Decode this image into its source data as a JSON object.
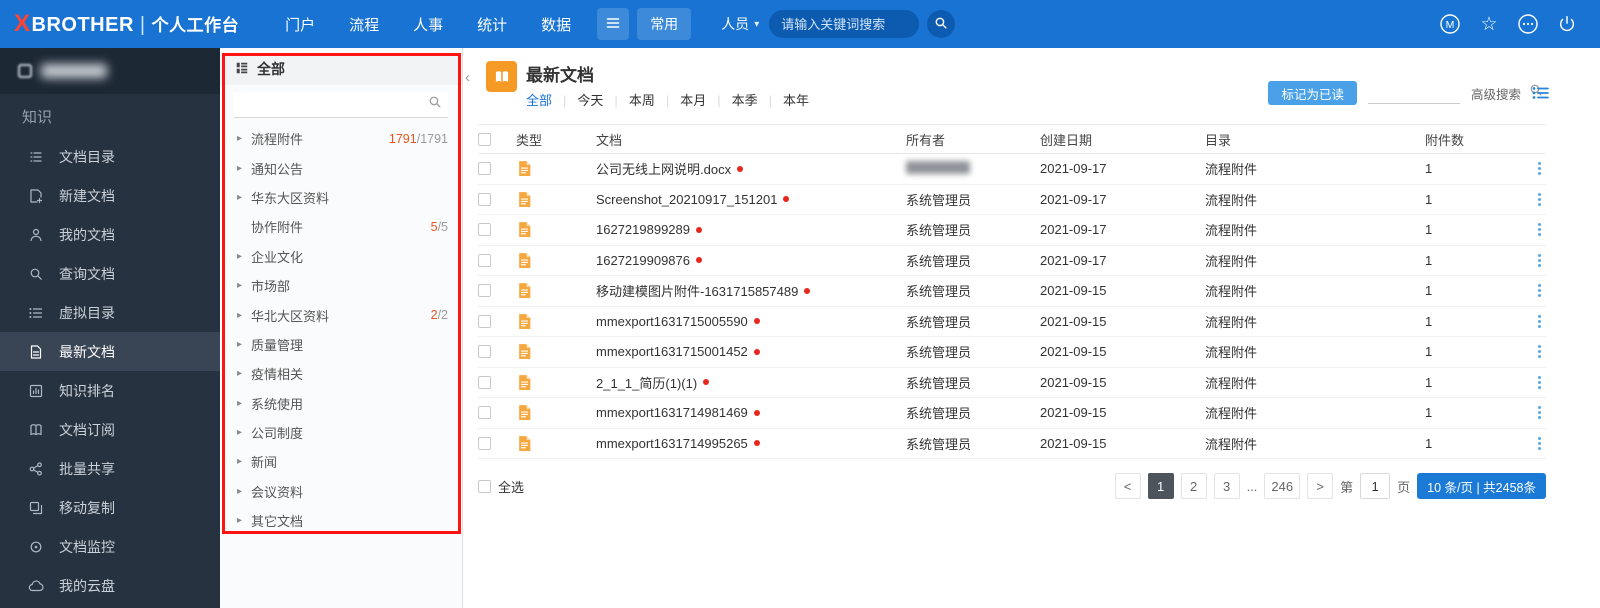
{
  "colors": {
    "accent": "#1873d3",
    "orange": "#f59b25",
    "red_dot": "#e8261d",
    "annotation": "#ff1414",
    "count_highlight": "#e8541e",
    "badge_blue": "#1b7ad5",
    "mark_read": "#4ba1e8"
  },
  "topbar": {
    "logo": {
      "x": "X",
      "rest": "BROTHER",
      "sep": "|",
      "workspace": "个人工作台"
    },
    "nav": [
      {
        "label": "门户"
      },
      {
        "label": "流程"
      },
      {
        "label": "人事"
      },
      {
        "label": "统计"
      },
      {
        "label": "数据"
      }
    ],
    "quick_label": "常用",
    "person_label": "人员",
    "search_placeholder": "请输入关键词搜索"
  },
  "sidebar": {
    "module": "知识",
    "items": [
      {
        "label": "文档目录",
        "icon": "doc-tree-icon"
      },
      {
        "label": "新建文档",
        "icon": "new-doc-icon"
      },
      {
        "label": "我的文档",
        "icon": "my-doc-icon"
      },
      {
        "label": "查询文档",
        "icon": "search-doc-icon"
      },
      {
        "label": "虚拟目录",
        "icon": "virtual-dir-icon"
      },
      {
        "label": "最新文档",
        "icon": "latest-doc-icon",
        "active": true
      },
      {
        "label": "知识排名",
        "icon": "ranking-icon"
      },
      {
        "label": "文档订阅",
        "icon": "subscribe-icon"
      },
      {
        "label": "批量共享",
        "icon": "share-icon"
      },
      {
        "label": "移动复制",
        "icon": "copy-icon"
      },
      {
        "label": "文档监控",
        "icon": "monitor-icon"
      },
      {
        "label": "我的云盘",
        "icon": "cloud-icon"
      }
    ]
  },
  "categories": {
    "header": "全部",
    "items": [
      {
        "label": "流程附件",
        "has_children": true,
        "count": "1791",
        "total": "/1791"
      },
      {
        "label": "通知公告",
        "has_children": true
      },
      {
        "label": "华东大区资料",
        "has_children": true
      },
      {
        "label": "协作附件",
        "has_children": false,
        "count": "5",
        "total": "/5"
      },
      {
        "label": "企业文化",
        "has_children": true
      },
      {
        "label": "市场部",
        "has_children": true
      },
      {
        "label": "华北大区资料",
        "has_children": true,
        "count": "2",
        "total": "/2"
      },
      {
        "label": "质量管理",
        "has_children": true
      },
      {
        "label": "疫情相关",
        "has_children": true
      },
      {
        "label": "系统使用",
        "has_children": true
      },
      {
        "label": "公司制度",
        "has_children": true
      },
      {
        "label": "新闻",
        "has_children": true
      },
      {
        "label": "会议资料",
        "has_children": true
      },
      {
        "label": "其它文档",
        "has_children": true
      }
    ]
  },
  "main": {
    "title": "最新文档",
    "collapse_glyph": "‹",
    "tabs": [
      {
        "label": "全部",
        "active": true
      },
      {
        "label": "今天"
      },
      {
        "label": "本周"
      },
      {
        "label": "本月"
      },
      {
        "label": "本季"
      },
      {
        "label": "本年"
      }
    ],
    "mark_read_label": "标记为已读",
    "advanced_search_label": "高级搜索",
    "table": {
      "columns": [
        "类型",
        "文档",
        "所有者",
        "创建日期",
        "目录",
        "附件数"
      ],
      "rows": [
        {
          "name": "公司无线上网说明.docx",
          "owner": "",
          "owner_redacted": true,
          "unread": true,
          "date": "2021-09-17",
          "dir": "流程附件",
          "attachments": "1"
        },
        {
          "name": "Screenshot_20210917_151201",
          "owner": "系统管理员",
          "unread": true,
          "date": "2021-09-17",
          "dir": "流程附件",
          "attachments": "1"
        },
        {
          "name": "1627219899289",
          "owner": "系统管理员",
          "unread": true,
          "date": "2021-09-17",
          "dir": "流程附件",
          "attachments": "1"
        },
        {
          "name": "1627219909876",
          "owner": "系统管理员",
          "unread": true,
          "date": "2021-09-17",
          "dir": "流程附件",
          "attachments": "1"
        },
        {
          "name": "移动建模图片附件-1631715857489",
          "owner": "系统管理员",
          "unread": true,
          "date": "2021-09-15",
          "dir": "流程附件",
          "attachments": "1"
        },
        {
          "name": "mmexport1631715005590",
          "owner": "系统管理员",
          "unread": true,
          "date": "2021-09-15",
          "dir": "流程附件",
          "attachments": "1"
        },
        {
          "name": "mmexport1631715001452",
          "owner": "系统管理员",
          "unread": true,
          "date": "2021-09-15",
          "dir": "流程附件",
          "attachments": "1"
        },
        {
          "name": "2_1_1_简历(1)(1)",
          "owner": "系统管理员",
          "unread": true,
          "date": "2021-09-15",
          "dir": "流程附件",
          "attachments": "1"
        },
        {
          "name": "mmexport1631714981469",
          "owner": "系统管理员",
          "unread": true,
          "date": "2021-09-15",
          "dir": "流程附件",
          "attachments": "1"
        },
        {
          "name": "mmexport1631714995265",
          "owner": "系统管理员",
          "unread": true,
          "date": "2021-09-15",
          "dir": "流程附件",
          "attachments": "1"
        }
      ]
    },
    "footer": {
      "select_all": "全选",
      "prev_label": "<",
      "pages": [
        {
          "label": "1",
          "active": true
        },
        {
          "label": "2"
        },
        {
          "label": "3"
        }
      ],
      "ellipsis": "...",
      "last_page": "246",
      "next_label": ">",
      "page_label_prefix": "第",
      "page_value": "1",
      "page_label_suffix": "页",
      "page_size_info": "10 条/页 | 共2458条"
    }
  }
}
